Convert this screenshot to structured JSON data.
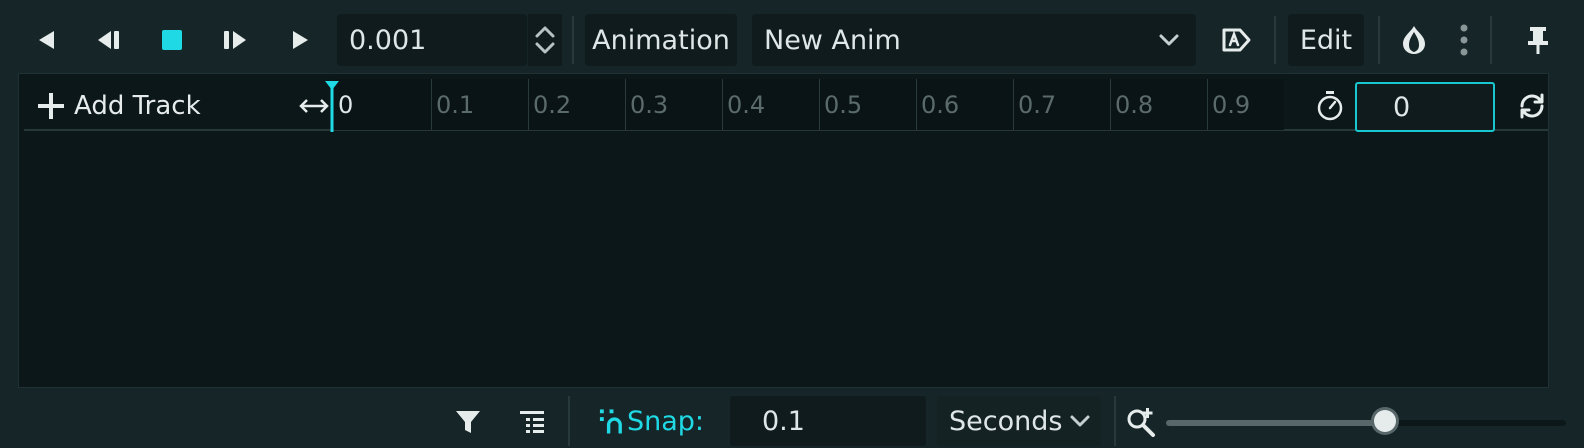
{
  "toolbar": {
    "speed_value": "0.001",
    "animation_label": "Animation",
    "current_animation": "New Anim",
    "edit_label": "Edit"
  },
  "timeline": {
    "add_track_label": "Add Track",
    "ticks": [
      "0",
      "0.1",
      "0.2",
      "0.3",
      "0.4",
      "0.5",
      "0.6",
      "0.7",
      "0.8",
      "0.9"
    ],
    "length_value": "0"
  },
  "bottom": {
    "snap_label": "Snap:",
    "snap_value": "0.1",
    "time_unit": "Seconds",
    "zoom_level": 0.55
  },
  "colors": {
    "accent": "#1fd9e4",
    "background": "#162628",
    "panel": "#0c1719"
  },
  "icons": [
    "play-backwards-icon",
    "play-backwards-from-end-icon",
    "stop-icon",
    "play-from-start-icon",
    "play-icon",
    "spinner-arrows-icon",
    "chevron-down-icon",
    "autoplay-icon",
    "onion-skin-icon",
    "more-options-icon",
    "pin-icon",
    "plus-icon",
    "resize-horizontal-icon",
    "playhead-marker-icon",
    "timer-icon",
    "loop-icon",
    "filter-icon",
    "list-icon",
    "snap-icon",
    "zoom-icon"
  ]
}
